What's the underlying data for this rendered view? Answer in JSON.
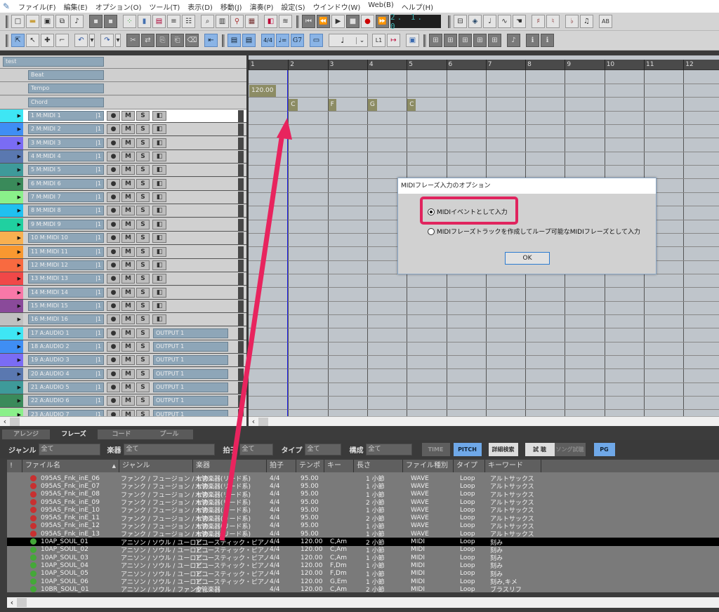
{
  "menu": [
    "ファイル(F)",
    "編集(E)",
    "オプション(O)",
    "ツール(T)",
    "表示(D)",
    "移動(J)",
    "演奏(P)",
    "設定(S)",
    "ウインドウ(W)",
    "Web(B)",
    "ヘルプ(H)"
  ],
  "transport": {
    "position": "2. 1. 0"
  },
  "toolbar2": {
    "note_value": "♩",
    "meter_label": "4/4",
    "tempo_label": "♩=",
    "chord_label": "G7",
    "marker_label": "L1"
  },
  "song": {
    "title": "test"
  },
  "special_tracks": [
    "Beat",
    "Tempo",
    "Chord"
  ],
  "tracks": [
    {
      "num": "1",
      "name": "M:MIDI 1",
      "ch": "1",
      "color": "#3ee6f4",
      "type": "midi",
      "selected": true
    },
    {
      "num": "2",
      "name": "M:MIDI 2",
      "ch": "1",
      "color": "#3f8ef4",
      "type": "midi"
    },
    {
      "num": "3",
      "name": "M:MIDI 3",
      "ch": "1",
      "color": "#7a6cf4",
      "type": "midi"
    },
    {
      "num": "4",
      "name": "M:MIDI 4",
      "ch": "1",
      "color": "#5a78b0",
      "type": "midi"
    },
    {
      "num": "5",
      "name": "M:MIDI 5",
      "ch": "1",
      "color": "#3e9a9a",
      "type": "midi"
    },
    {
      "num": "6",
      "name": "M:MIDI 6",
      "ch": "1",
      "color": "#3a8a5a",
      "type": "midi"
    },
    {
      "num": "7",
      "name": "M:MIDI 7",
      "ch": "1",
      "color": "#8af08a",
      "type": "midi"
    },
    {
      "num": "8",
      "name": "M:MIDI 8",
      "ch": "1",
      "color": "#20c0f0",
      "type": "midi"
    },
    {
      "num": "9",
      "name": "M:MIDI 9",
      "ch": "1",
      "color": "#20d0a0",
      "type": "midi"
    },
    {
      "num": "10",
      "name": "M:MIDI 10",
      "ch": "1",
      "color": "#f8b050",
      "type": "midi"
    },
    {
      "num": "11",
      "name": "M:MIDI 11",
      "ch": "1",
      "color": "#f89830",
      "type": "midi"
    },
    {
      "num": "12",
      "name": "M:MIDI 12",
      "ch": "1",
      "color": "#f86a40",
      "type": "midi"
    },
    {
      "num": "13",
      "name": "M:MIDI 13",
      "ch": "1",
      "color": "#f04848",
      "type": "midi"
    },
    {
      "num": "14",
      "name": "M:MIDI 14",
      "ch": "1",
      "color": "#f878a8",
      "type": "midi"
    },
    {
      "num": "15",
      "name": "M:MIDI 15",
      "ch": "1",
      "color": "#8a4a9a",
      "type": "midi"
    },
    {
      "num": "16",
      "name": "M:MIDI 16",
      "ch": "1",
      "color": "#c0c0c0",
      "type": "midi"
    },
    {
      "num": "17",
      "name": "A:AUDIO 1",
      "ch": "1",
      "color": "#3ee6f4",
      "type": "audio",
      "output": "OUTPUT 1"
    },
    {
      "num": "18",
      "name": "A:AUDIO 2",
      "ch": "1",
      "color": "#3f8ef4",
      "type": "audio",
      "output": "OUTPUT 1"
    },
    {
      "num": "19",
      "name": "A:AUDIO 3",
      "ch": "1",
      "color": "#7a6cf4",
      "type": "audio",
      "output": "OUTPUT 1"
    },
    {
      "num": "20",
      "name": "A:AUDIO 4",
      "ch": "1",
      "color": "#5a78b0",
      "type": "audio",
      "output": "OUTPUT 1"
    },
    {
      "num": "21",
      "name": "A:AUDIO 5",
      "ch": "1",
      "color": "#3e9a9a",
      "type": "audio",
      "output": "OUTPUT 1"
    },
    {
      "num": "22",
      "name": "A:AUDIO 6",
      "ch": "1",
      "color": "#3a8a5a",
      "type": "audio",
      "output": "OUTPUT 1"
    },
    {
      "num": "23",
      "name": "A:AUDIO 7",
      "ch": "1",
      "color": "#8af08a",
      "type": "audio",
      "output": "OUTPUT 1"
    }
  ],
  "track_buttons": {
    "rec": "●",
    "mute": "M",
    "solo": "S",
    "monitor": "◧"
  },
  "ruler": [
    "1",
    "2",
    "3",
    "4",
    "5",
    "6",
    "7",
    "8",
    "9",
    "10",
    "11",
    "12"
  ],
  "tempo_event": "120.00",
  "chords": [
    {
      "bar": 2,
      "label": "C"
    },
    {
      "bar": 3,
      "label": "F"
    },
    {
      "bar": 4,
      "label": "G"
    },
    {
      "bar": 5,
      "label": "C"
    }
  ],
  "dialog": {
    "title": "MIDIフレーズ入力のオプション",
    "option1": "MIDIイベントとして入力",
    "option2": "MIDIフレーズトラックを作成してループ可能なMIDIフレーズとして入力",
    "selected": 1,
    "ok": "OK"
  },
  "bottom": {
    "tabs": [
      "アレンジ",
      "フレーズ",
      "コード",
      "プール"
    ],
    "active_tab": 1,
    "filters": [
      {
        "label": "ジャンル",
        "value": "全て"
      },
      {
        "label": "楽器",
        "value": "全て"
      },
      {
        "label": "拍子",
        "value": "全て"
      },
      {
        "label": "タイプ",
        "value": "全て"
      },
      {
        "label": "構成",
        "value": "全て"
      }
    ],
    "buttons": {
      "time": "TIME",
      "pitch": "PITCH",
      "detail": "詳細検索",
      "audition": "試 聴",
      "song_audition": "ソング試聴",
      "pg": "PG"
    },
    "columns": [
      "!",
      "ファイル名",
      "ジャンル",
      "楽器",
      "拍子",
      "テンポ",
      "キー",
      "長さ",
      "ファイル種別",
      "タイプ",
      "キーワード"
    ],
    "sort_indicator": "▲",
    "rows": [
      {
        "icon": "wave",
        "name": "095AS_Fnk_inE_06",
        "genre": "ファンク / フュージョン / セカ...",
        "inst": "木管楽器(リード系)",
        "meter": "4/4",
        "tempo": "95.00",
        "key": "",
        "len": "1 小節",
        "ftype": "WAVE",
        "type": "Loop",
        "kw": "アルトサックス"
      },
      {
        "icon": "wave",
        "name": "095AS_Fnk_inE_07",
        "genre": "ファンク / フュージョン / セカ...",
        "inst": "木管楽器(リード系)",
        "meter": "4/4",
        "tempo": "95.00",
        "key": "",
        "len": "1 小節",
        "ftype": "WAVE",
        "type": "Loop",
        "kw": "アルトサックス"
      },
      {
        "icon": "wave",
        "name": "095AS_Fnk_inE_08",
        "genre": "ファンク / フュージョン / セカ...",
        "inst": "木管楽器(リード系)",
        "meter": "4/4",
        "tempo": "95.00",
        "key": "",
        "len": "1 小節",
        "ftype": "WAVE",
        "type": "Loop",
        "kw": "アルトサックス"
      },
      {
        "icon": "wave",
        "name": "095AS_Fnk_inE_09",
        "genre": "ファンク / フュージョン / セカ...",
        "inst": "木管楽器(リード系)",
        "meter": "4/4",
        "tempo": "95.00",
        "key": "",
        "len": "2 小節",
        "ftype": "WAVE",
        "type": "Loop",
        "kw": "アルトサックス"
      },
      {
        "icon": "wave",
        "name": "095AS_Fnk_inE_10",
        "genre": "ファンク / フュージョン / セカ...",
        "inst": "木管楽器(リード系)",
        "meter": "4/4",
        "tempo": "95.00",
        "key": "",
        "len": "1 小節",
        "ftype": "WAVE",
        "type": "Loop",
        "kw": "アルトサックス"
      },
      {
        "icon": "wave",
        "name": "095AS_Fnk_inE_11",
        "genre": "ファンク / フュージョン / セカ...",
        "inst": "木管楽器(リード系)",
        "meter": "4/4",
        "tempo": "95.00",
        "key": "",
        "len": "2 小節",
        "ftype": "WAVE",
        "type": "Loop",
        "kw": "アルトサックス"
      },
      {
        "icon": "wave",
        "name": "095AS_Fnk_inE_12",
        "genre": "ファンク / フュージョン / セカ...",
        "inst": "木管楽器(リード系)",
        "meter": "4/4",
        "tempo": "95.00",
        "key": "",
        "len": "1 小節",
        "ftype": "WAVE",
        "type": "Loop",
        "kw": "アルトサックス"
      },
      {
        "icon": "wave",
        "name": "095AS_Fnk_inE_13",
        "genre": "ファンク / フュージョン / セカ...",
        "inst": "木管楽器(リード系)",
        "meter": "4/4",
        "tempo": "95.00",
        "key": "",
        "len": "1 小節",
        "ftype": "WAVE",
        "type": "Loop",
        "kw": "アルトサックス"
      },
      {
        "icon": "midi",
        "name": "10AP_SOUL_01",
        "genre": "アニソン / ソウル / ユーロビ...",
        "inst": "アコースティック・ピアノ",
        "meter": "4/4",
        "tempo": "120.00",
        "key": "C,Am",
        "len": "2 小節",
        "ftype": "MIDI",
        "type": "Loop",
        "kw": "刻み",
        "selected": true
      },
      {
        "icon": "midi",
        "name": "10AP_SOUL_02",
        "genre": "アニソン / ソウル / ユーロビ...",
        "inst": "アコースティック・ピアノ",
        "meter": "4/4",
        "tempo": "120.00",
        "key": "C,Am",
        "len": "1 小節",
        "ftype": "MIDI",
        "type": "Loop",
        "kw": "刻み"
      },
      {
        "icon": "midi",
        "name": "10AP_SOUL_03",
        "genre": "アニソン / ソウル / ユーロビ...",
        "inst": "アコースティック・ピアノ",
        "meter": "4/4",
        "tempo": "120.00",
        "key": "C,Am",
        "len": "1 小節",
        "ftype": "MIDI",
        "type": "Loop",
        "kw": "刻み"
      },
      {
        "icon": "midi",
        "name": "10AP_SOUL_04",
        "genre": "アニソン / ソウル / ユーロビ...",
        "inst": "アコースティック・ピアノ",
        "meter": "4/4",
        "tempo": "120.00",
        "key": "F,Dm",
        "len": "1 小節",
        "ftype": "MIDI",
        "type": "Loop",
        "kw": "刻み"
      },
      {
        "icon": "midi",
        "name": "10AP_SOUL_05",
        "genre": "アニソン / ソウル / ユーロビ...",
        "inst": "アコースティック・ピアノ",
        "meter": "4/4",
        "tempo": "120.00",
        "key": "F,Dm",
        "len": "1 小節",
        "ftype": "MIDI",
        "type": "Loop",
        "kw": "刻み"
      },
      {
        "icon": "midi",
        "name": "10AP_SOUL_06",
        "genre": "アニソン / ソウル / ユーロビ...",
        "inst": "アコースティック・ピアノ",
        "meter": "4/4",
        "tempo": "120.00",
        "key": "G,Em",
        "len": "1 小節",
        "ftype": "MIDI",
        "type": "Loop",
        "kw": "刻み,キメ"
      },
      {
        "icon": "midi",
        "name": "10BR_SOUL_01",
        "genre": "アニソン / ソウル / ファンク ...",
        "inst": "金管楽器",
        "meter": "4/4",
        "tempo": "120.00",
        "key": "C,Am",
        "len": "2 小節",
        "ftype": "MIDI",
        "type": "Loop",
        "kw": "ブラスリフ"
      }
    ]
  },
  "annotation_color": "#e8245e"
}
